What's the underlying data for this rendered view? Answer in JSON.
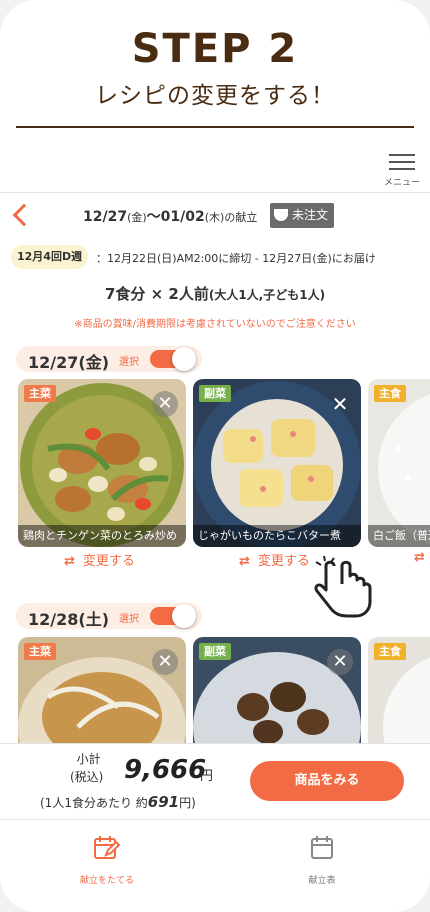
{
  "step": {
    "title": "STEP 2",
    "subtitle": "レシピの変更をする！"
  },
  "menu": {
    "label": "メニュー"
  },
  "period": {
    "start": "12/27",
    "start_day": "(金)",
    "sep": "～",
    "end": "01/02",
    "end_day": "(木)",
    "suffix": "の献立"
  },
  "order_status": "未注文",
  "week": {
    "label": "12月4回D週",
    "info": "：12月22日(日)AM2:00に締切 - 12月27日(金)にお届け"
  },
  "servings": {
    "main": "7食分 × 2人前",
    "detail": "(大人1人,子ども1人)"
  },
  "notice": "※商品の賞味/消費期限は考慮されていないのでご注意ください",
  "days": [
    {
      "label": "12/27(金)",
      "select_label": "選択",
      "selected": true,
      "change_label": "変更する",
      "meals": [
        {
          "tag": "主菜",
          "name": "鶏肉とチンゲン菜のとろみ炒め"
        },
        {
          "tag": "副菜",
          "name": "じゃがいものたらこバター煮"
        },
        {
          "tag": "主食",
          "name": "白ご飯（普通）"
        }
      ]
    },
    {
      "label": "12/28(土)",
      "select_label": "選択",
      "selected": true,
      "meals": [
        {
          "tag": "主菜",
          "name": ""
        },
        {
          "tag": "副菜",
          "name": ""
        },
        {
          "tag": "主食",
          "name": ""
        }
      ]
    }
  ],
  "footer": {
    "subtotal_label": "小計",
    "tax_label": "(税込)",
    "price": "9,666",
    "price_unit": "円",
    "per_meal_prefix": "(1人1食分あたり 約",
    "per_meal_value": "691",
    "per_meal_suffix": "円)",
    "cta": "商品をみる"
  },
  "tabs": [
    {
      "label": "献立をたてる",
      "icon": "edit-calendar-icon",
      "active": true
    },
    {
      "label": "献立表",
      "icon": "calendar-icon",
      "active": false
    }
  ],
  "colors": {
    "accent": "#f26b45",
    "brown": "#4a2c12",
    "main_tag": "#f07a4a",
    "side_tag": "#76b04a",
    "staple_tag": "#f0b12c"
  }
}
